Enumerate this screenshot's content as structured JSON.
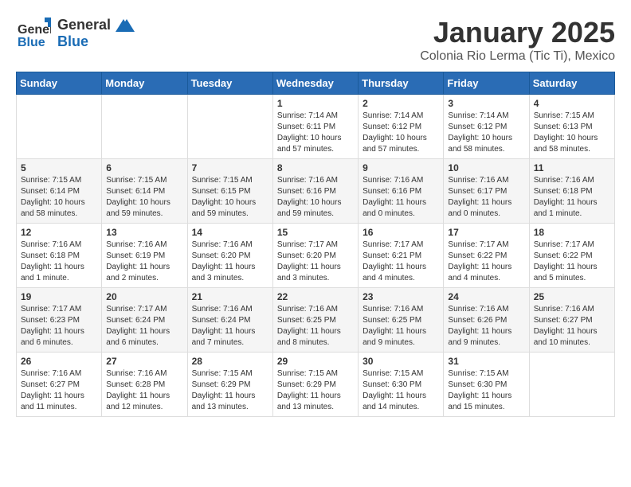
{
  "logo": {
    "general": "General",
    "blue": "Blue"
  },
  "title": "January 2025",
  "subtitle": "Colonia Rio Lerma (Tic Ti), Mexico",
  "headers": [
    "Sunday",
    "Monday",
    "Tuesday",
    "Wednesday",
    "Thursday",
    "Friday",
    "Saturday"
  ],
  "weeks": [
    [
      {
        "day": "",
        "info": ""
      },
      {
        "day": "",
        "info": ""
      },
      {
        "day": "",
        "info": ""
      },
      {
        "day": "1",
        "info": "Sunrise: 7:14 AM\nSunset: 6:11 PM\nDaylight: 10 hours\nand 57 minutes."
      },
      {
        "day": "2",
        "info": "Sunrise: 7:14 AM\nSunset: 6:12 PM\nDaylight: 10 hours\nand 57 minutes."
      },
      {
        "day": "3",
        "info": "Sunrise: 7:14 AM\nSunset: 6:12 PM\nDaylight: 10 hours\nand 58 minutes."
      },
      {
        "day": "4",
        "info": "Sunrise: 7:15 AM\nSunset: 6:13 PM\nDaylight: 10 hours\nand 58 minutes."
      }
    ],
    [
      {
        "day": "5",
        "info": "Sunrise: 7:15 AM\nSunset: 6:14 PM\nDaylight: 10 hours\nand 58 minutes."
      },
      {
        "day": "6",
        "info": "Sunrise: 7:15 AM\nSunset: 6:14 PM\nDaylight: 10 hours\nand 59 minutes."
      },
      {
        "day": "7",
        "info": "Sunrise: 7:15 AM\nSunset: 6:15 PM\nDaylight: 10 hours\nand 59 minutes."
      },
      {
        "day": "8",
        "info": "Sunrise: 7:16 AM\nSunset: 6:16 PM\nDaylight: 10 hours\nand 59 minutes."
      },
      {
        "day": "9",
        "info": "Sunrise: 7:16 AM\nSunset: 6:16 PM\nDaylight: 11 hours\nand 0 minutes."
      },
      {
        "day": "10",
        "info": "Sunrise: 7:16 AM\nSunset: 6:17 PM\nDaylight: 11 hours\nand 0 minutes."
      },
      {
        "day": "11",
        "info": "Sunrise: 7:16 AM\nSunset: 6:18 PM\nDaylight: 11 hours\nand 1 minute."
      }
    ],
    [
      {
        "day": "12",
        "info": "Sunrise: 7:16 AM\nSunset: 6:18 PM\nDaylight: 11 hours\nand 1 minute."
      },
      {
        "day": "13",
        "info": "Sunrise: 7:16 AM\nSunset: 6:19 PM\nDaylight: 11 hours\nand 2 minutes."
      },
      {
        "day": "14",
        "info": "Sunrise: 7:16 AM\nSunset: 6:20 PM\nDaylight: 11 hours\nand 3 minutes."
      },
      {
        "day": "15",
        "info": "Sunrise: 7:17 AM\nSunset: 6:20 PM\nDaylight: 11 hours\nand 3 minutes."
      },
      {
        "day": "16",
        "info": "Sunrise: 7:17 AM\nSunset: 6:21 PM\nDaylight: 11 hours\nand 4 minutes."
      },
      {
        "day": "17",
        "info": "Sunrise: 7:17 AM\nSunset: 6:22 PM\nDaylight: 11 hours\nand 4 minutes."
      },
      {
        "day": "18",
        "info": "Sunrise: 7:17 AM\nSunset: 6:22 PM\nDaylight: 11 hours\nand 5 minutes."
      }
    ],
    [
      {
        "day": "19",
        "info": "Sunrise: 7:17 AM\nSunset: 6:23 PM\nDaylight: 11 hours\nand 6 minutes."
      },
      {
        "day": "20",
        "info": "Sunrise: 7:17 AM\nSunset: 6:24 PM\nDaylight: 11 hours\nand 6 minutes."
      },
      {
        "day": "21",
        "info": "Sunrise: 7:16 AM\nSunset: 6:24 PM\nDaylight: 11 hours\nand 7 minutes."
      },
      {
        "day": "22",
        "info": "Sunrise: 7:16 AM\nSunset: 6:25 PM\nDaylight: 11 hours\nand 8 minutes."
      },
      {
        "day": "23",
        "info": "Sunrise: 7:16 AM\nSunset: 6:25 PM\nDaylight: 11 hours\nand 9 minutes."
      },
      {
        "day": "24",
        "info": "Sunrise: 7:16 AM\nSunset: 6:26 PM\nDaylight: 11 hours\nand 9 minutes."
      },
      {
        "day": "25",
        "info": "Sunrise: 7:16 AM\nSunset: 6:27 PM\nDaylight: 11 hours\nand 10 minutes."
      }
    ],
    [
      {
        "day": "26",
        "info": "Sunrise: 7:16 AM\nSunset: 6:27 PM\nDaylight: 11 hours\nand 11 minutes."
      },
      {
        "day": "27",
        "info": "Sunrise: 7:16 AM\nSunset: 6:28 PM\nDaylight: 11 hours\nand 12 minutes."
      },
      {
        "day": "28",
        "info": "Sunrise: 7:15 AM\nSunset: 6:29 PM\nDaylight: 11 hours\nand 13 minutes."
      },
      {
        "day": "29",
        "info": "Sunrise: 7:15 AM\nSunset: 6:29 PM\nDaylight: 11 hours\nand 13 minutes."
      },
      {
        "day": "30",
        "info": "Sunrise: 7:15 AM\nSunset: 6:30 PM\nDaylight: 11 hours\nand 14 minutes."
      },
      {
        "day": "31",
        "info": "Sunrise: 7:15 AM\nSunset: 6:30 PM\nDaylight: 11 hours\nand 15 minutes."
      },
      {
        "day": "",
        "info": ""
      }
    ]
  ]
}
